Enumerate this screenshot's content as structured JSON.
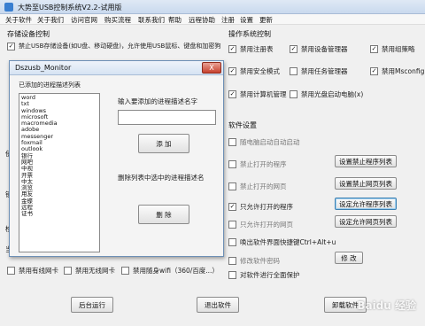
{
  "title": "大势至USB控制系统V2.2-试用版",
  "menu": [
    "关于软件",
    "关于我们",
    "访问官网",
    "购买流程",
    "联系我们",
    "帮助",
    "远程协助",
    "注册",
    "设置",
    "更新"
  ],
  "storage_section": "存储设备控制",
  "storage_option": "禁止USB存储设备(如U盘、移动硬盘)，允许使用USB鼠标、键盘和加密狗",
  "system_section": "操作系统控制",
  "sys_checks": [
    {
      "label": "禁用注册表",
      "checked": true
    },
    {
      "label": "禁用设备管理器",
      "checked": true
    },
    {
      "label": "禁用组策略",
      "checked": true
    },
    {
      "label": "禁用安全模式",
      "checked": true
    },
    {
      "label": "禁用任务管理器",
      "checked": false
    },
    {
      "label": "禁用Msconfig",
      "checked": true
    },
    {
      "label": "禁用计算机管理",
      "checked": true
    },
    {
      "label": "禁用光盘启动电脑(x)",
      "checked": false
    }
  ],
  "software_section": "软件设置",
  "sw_rows": [
    {
      "label": "随电脑启动自动启动",
      "checked": false,
      "button": ""
    },
    {
      "label": "禁止打开的程序",
      "checked": false,
      "button": "设置禁止程序列表"
    },
    {
      "label": "禁止打开的网页",
      "checked": false,
      "button": "设置禁止网页列表"
    },
    {
      "label": "只允许打开的程序",
      "checked": true,
      "button": "设定允许程序列表"
    },
    {
      "label": "只允许打开的网页",
      "checked": false,
      "button": "设定允许网页列表"
    },
    {
      "label": "唤出软件界面快捷键Ctrl+Alt+u",
      "checked": false,
      "button": ""
    },
    {
      "label": "修改软件密码",
      "checked": false,
      "button": "修 改"
    },
    {
      "label": "对软件进行全面保护",
      "checked": false,
      "button": ""
    }
  ],
  "bottom_checks": [
    "禁用有线网卡",
    "禁用无线网卡",
    "禁用随身wifi（360/百度...）"
  ],
  "bottom_buttons": [
    "后台运行",
    "退出软件",
    "卸载软件"
  ],
  "left_partial": [
    "使",
    "锁",
    "当",
    "检"
  ],
  "dialog": {
    "title": "Dszusb_Monitor",
    "close": "X",
    "list_caption": "已添加的进程描述列表",
    "list": [
      "word",
      "txt",
      "windows",
      "microsoft",
      "macromedia",
      "adobe",
      "messenger",
      "foxmail",
      "outlook",
      "银行",
      "网吧",
      "中视",
      "开票",
      "中太",
      "浏览",
      "用友",
      "金蝶",
      "远程",
      "证书"
    ],
    "input_label": "输入要添加的进程描述名字",
    "input_value": "",
    "add_button": "添 加",
    "delete_label": "删除列表中选中的进程描述名",
    "delete_button": "删 除"
  },
  "watermark": "Baidu 经验"
}
